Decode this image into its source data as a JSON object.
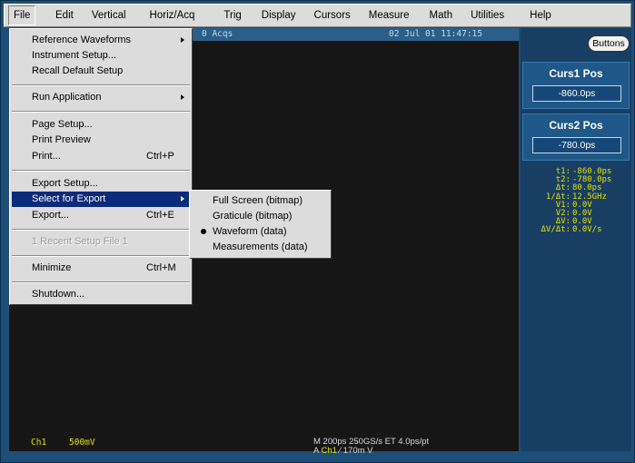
{
  "menubar": {
    "items": [
      {
        "label": "File"
      },
      {
        "label": "Edit"
      },
      {
        "label": "Vertical"
      },
      {
        "label": "Horiz/Acq"
      },
      {
        "label": "Trig"
      },
      {
        "label": "Display"
      },
      {
        "label": "Cursors"
      },
      {
        "label": "Measure"
      },
      {
        "label": "Math"
      },
      {
        "label": "Utilities"
      },
      {
        "label": "Help"
      }
    ]
  },
  "status": {
    "acqs": "0 Acqs",
    "datetime": "02 Jul 01 11:47:15"
  },
  "file_menu": {
    "items": [
      {
        "label": "Reference Waveforms",
        "shortcut": ""
      },
      {
        "label": "Instrument Setup...",
        "shortcut": ""
      },
      {
        "label": "Recall Default Setup",
        "shortcut": ""
      },
      {
        "label": "Run Application",
        "shortcut": ""
      },
      {
        "label": "Page Setup...",
        "shortcut": ""
      },
      {
        "label": "Print Preview",
        "shortcut": ""
      },
      {
        "label": "Print...",
        "shortcut": "Ctrl+P"
      },
      {
        "label": "Export Setup...",
        "shortcut": ""
      },
      {
        "label": "Select for Export",
        "shortcut": ""
      },
      {
        "label": "Export...",
        "shortcut": "Ctrl+E"
      },
      {
        "label": "1 Recent Setup File 1",
        "shortcut": ""
      },
      {
        "label": "Minimize",
        "shortcut": "Ctrl+M"
      },
      {
        "label": "Shutdown...",
        "shortcut": ""
      }
    ]
  },
  "export_submenu": {
    "items": [
      {
        "label": "Full Screen (bitmap)",
        "selected": false
      },
      {
        "label": "Graticule (bitmap)",
        "selected": false
      },
      {
        "label": "Waveform (data)",
        "selected": true
      },
      {
        "label": "Measurements (data)",
        "selected": false
      }
    ]
  },
  "right_panel": {
    "buttons_label": "Buttons",
    "curs1": {
      "title": "Curs1 Pos",
      "value": "-860.0ps"
    },
    "curs2": {
      "title": "Curs2 Pos",
      "value": "-780.0ps"
    },
    "readout": [
      {
        "label": "t1:",
        "value": "-860.0ps"
      },
      {
        "label": "t2:",
        "value": "-780.0ps"
      },
      {
        "label": "Δt:",
        "value": "80.0ps"
      },
      {
        "label": "1/Δt:",
        "value": "12.5GHz"
      },
      {
        "label": "V1:",
        "value": "0.0V"
      },
      {
        "label": "V2:",
        "value": "0.0V"
      },
      {
        "label": "ΔV:",
        "value": "0.0V"
      },
      {
        "label": "ΔV/Δt:",
        "value": "0.0V/s"
      }
    ]
  },
  "bottom": {
    "channel": "Ch1",
    "scale": "500mV",
    "horiz_line1": "M 200ps 250GS/s ET 4.0ps/pt",
    "horiz_line2_prefix": "A",
    "horiz_line2_channel": "Ch1",
    "horiz_line2_slope": "⁄",
    "horiz_line2_level": "170m",
    "horiz_line2_suffix": "V"
  },
  "colors": {
    "bezel": "#1e4d78",
    "menu_bg": "#dcdcdc",
    "highlight": "#0a2a7c",
    "trace_yellow": "#e8e200",
    "display_bg": "#161616"
  }
}
